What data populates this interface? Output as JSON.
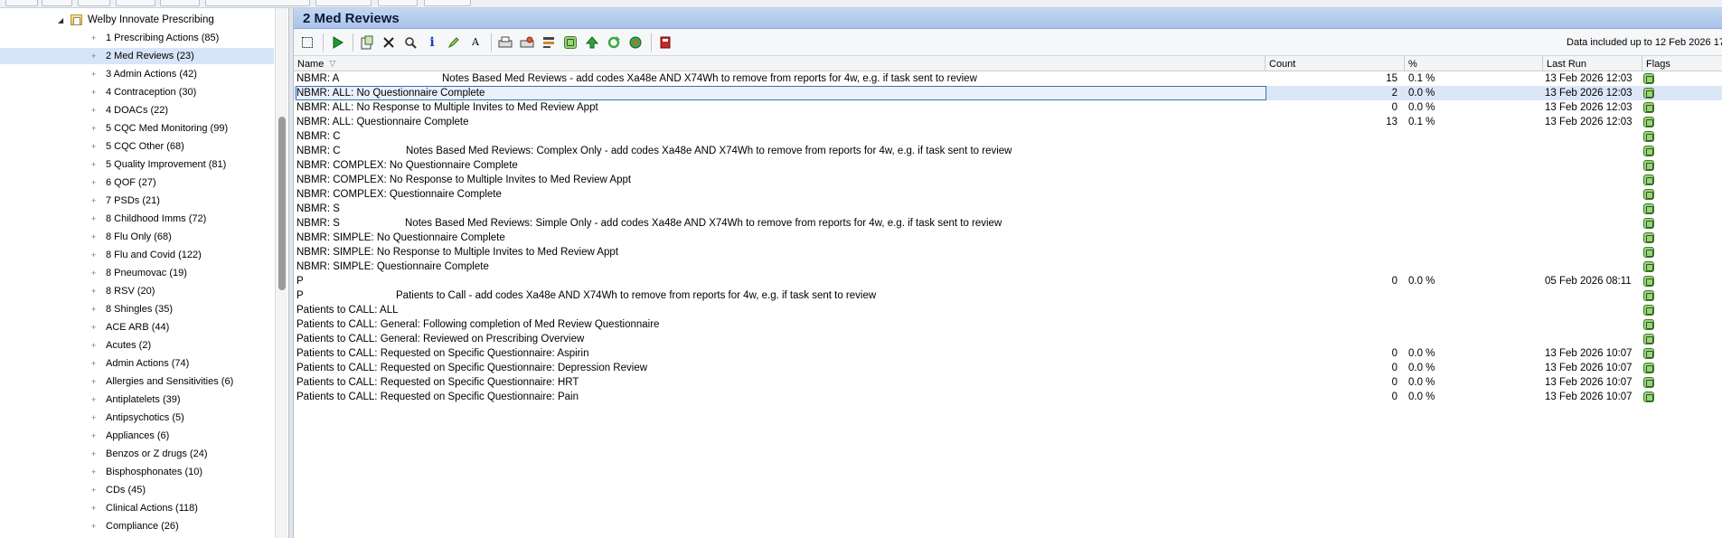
{
  "tree": {
    "root_label": "Welby Innovate Prescribing",
    "items": [
      {
        "label": "1 Prescribing Actions (85)"
      },
      {
        "label": "2 Med Reviews (23)",
        "selected": true
      },
      {
        "label": "3 Admin Actions (42)"
      },
      {
        "label": "4 Contraception (30)"
      },
      {
        "label": "4 DOACs (22)"
      },
      {
        "label": "5 CQC Med Monitoring (99)"
      },
      {
        "label": "5 CQC Other (68)"
      },
      {
        "label": "5 Quality Improvement (81)"
      },
      {
        "label": "6 QOF (27)"
      },
      {
        "label": "7 PSDs (21)"
      },
      {
        "label": "8 Childhood Imms (72)"
      },
      {
        "label": "8 Flu Only (68)"
      },
      {
        "label": "8 Flu and Covid (122)"
      },
      {
        "label": "8 Pneumovac (19)"
      },
      {
        "label": "8 RSV (20)"
      },
      {
        "label": "8 Shingles (35)"
      },
      {
        "label": "ACE ARB (44)"
      },
      {
        "label": "Acutes (2)"
      },
      {
        "label": "Admin Actions (74)"
      },
      {
        "label": "Allergies and Sensitivities (6)"
      },
      {
        "label": "Antiplatelets (39)"
      },
      {
        "label": "Antipsychotics (5)"
      },
      {
        "label": "Appliances (6)"
      },
      {
        "label": "Benzos or Z drugs (24)"
      },
      {
        "label": "Bisphosphonates (10)"
      },
      {
        "label": "CDs (45)"
      },
      {
        "label": "Clinical Actions (118)"
      },
      {
        "label": "Compliance (26)"
      }
    ]
  },
  "panel": {
    "title": "2 Med Reviews",
    "data_note": "Data included up to 12 Feb 2026 17:"
  },
  "toolbar": {
    "buttons": [
      "select-all-icon",
      "run-icon",
      "export-icon",
      "delete-icon",
      "search-icon",
      "info-icon",
      "edit-icon",
      "font-icon",
      "print-icon",
      "print-preview-icon",
      "columns-icon",
      "flag-icon",
      "move-up-icon",
      "refresh-icon",
      "schedule-icon",
      "book-icon"
    ]
  },
  "columns": {
    "name": "Name",
    "count": "Count",
    "pct": "%",
    "last_run": "Last Run",
    "flags": "Flags"
  },
  "rows": [
    {
      "name": "NBMR: A",
      "desc": "Notes Based Med Reviews - add codes Xa48e AND X74Wh to remove from reports for 4w, e.g. if task sent to review",
      "count": "15",
      "pct": "0.1 %",
      "last_run": "13 Feb 2026 12:03"
    },
    {
      "name": "NBMR: ALL: No Questionnaire Complete",
      "desc": "",
      "count": "2",
      "pct": "0.0 %",
      "last_run": "13 Feb 2026 12:03",
      "selected": true
    },
    {
      "name": "NBMR: ALL: No Response to Multiple Invites to Med Review Appt",
      "desc": "",
      "count": "0",
      "pct": "0.0 %",
      "last_run": "13 Feb 2026 12:03"
    },
    {
      "name": "NBMR: ALL: Questionnaire Complete",
      "desc": "",
      "count": "13",
      "pct": "0.1 %",
      "last_run": "13 Feb 2026 12:03"
    },
    {
      "name": "NBMR: C",
      "desc": "",
      "count": "",
      "pct": "",
      "last_run": ""
    },
    {
      "name": "NBMR: C",
      "desc": "Notes Based Med Reviews: Complex Only - add codes Xa48e AND X74Wh to remove from reports for 4w, e.g. if task sent to review",
      "count": "",
      "pct": "",
      "last_run": ""
    },
    {
      "name": "NBMR: COMPLEX: No Questionnaire Complete",
      "desc": "",
      "count": "",
      "pct": "",
      "last_run": ""
    },
    {
      "name": "NBMR: COMPLEX: No Response to Multiple Invites to Med Review Appt",
      "desc": "",
      "count": "",
      "pct": "",
      "last_run": ""
    },
    {
      "name": "NBMR: COMPLEX: Questionnaire Complete",
      "desc": "",
      "count": "",
      "pct": "",
      "last_run": ""
    },
    {
      "name": "NBMR: S",
      "desc": "",
      "count": "",
      "pct": "",
      "last_run": ""
    },
    {
      "name": "NBMR: S",
      "desc": "Notes Based Med Reviews: Simple Only - add codes Xa48e AND X74Wh to remove from reports for 4w, e.g. if task sent to review",
      "count": "",
      "pct": "",
      "last_run": ""
    },
    {
      "name": "NBMR: SIMPLE: No Questionnaire Complete",
      "desc": "",
      "count": "",
      "pct": "",
      "last_run": ""
    },
    {
      "name": "NBMR: SIMPLE: No Response to Multiple Invites to Med Review Appt",
      "desc": "",
      "count": "",
      "pct": "",
      "last_run": ""
    },
    {
      "name": "NBMR: SIMPLE: Questionnaire Complete",
      "desc": "",
      "count": "",
      "pct": "",
      "last_run": ""
    },
    {
      "name": "P",
      "desc": "",
      "count": "0",
      "pct": "0.0 %",
      "last_run": "05 Feb 2026 08:11"
    },
    {
      "name": "P",
      "desc": "Patients to Call - add codes Xa48e AND X74Wh to remove from reports for 4w, e.g. if task sent to review",
      "count": "",
      "pct": "",
      "last_run": ""
    },
    {
      "name": "Patients to CALL: ALL",
      "desc": "",
      "count": "",
      "pct": "",
      "last_run": ""
    },
    {
      "name": "Patients to CALL: General: Following completion of Med Review Questionnaire",
      "desc": "",
      "count": "",
      "pct": "",
      "last_run": ""
    },
    {
      "name": "Patients to CALL: General: Reviewed on Prescribing Overview",
      "desc": "",
      "count": "",
      "pct": "",
      "last_run": ""
    },
    {
      "name": "Patients to CALL: Requested on Specific Questionnaire: Aspirin",
      "desc": "",
      "count": "0",
      "pct": "0.0 %",
      "last_run": "13 Feb 2026 10:07"
    },
    {
      "name": "Patients to CALL: Requested on Specific Questionnaire: Depression Review",
      "desc": "",
      "count": "0",
      "pct": "0.0 %",
      "last_run": "13 Feb 2026 10:07"
    },
    {
      "name": "Patients to CALL: Requested on Specific Questionnaire: HRT",
      "desc": "",
      "count": "0",
      "pct": "0.0 %",
      "last_run": "13 Feb 2026 10:07"
    },
    {
      "name": "Patients to CALL: Requested on Specific Questionnaire: Pain",
      "desc": "",
      "count": "0",
      "pct": "0.0 %",
      "last_run": "13 Feb 2026 10:07"
    }
  ]
}
